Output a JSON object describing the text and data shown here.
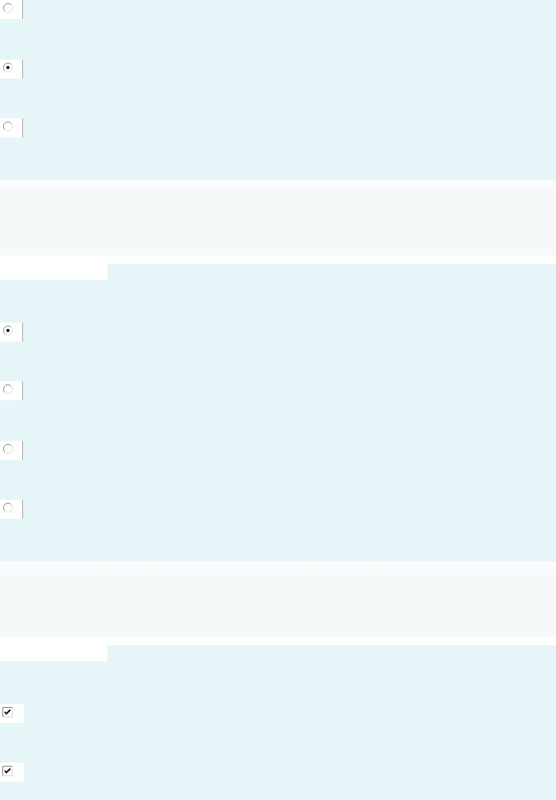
{
  "questions": [
    {
      "kind": "radio",
      "options": [
        {
          "selected": false
        },
        {
          "selected": true
        },
        {
          "selected": false
        }
      ]
    },
    {
      "kind": "radio",
      "options": [
        {
          "selected": true
        },
        {
          "selected": false
        },
        {
          "selected": false
        },
        {
          "selected": false
        }
      ]
    },
    {
      "kind": "checkbox",
      "options": [
        {
          "checked": true
        },
        {
          "checked": true
        }
      ]
    }
  ]
}
